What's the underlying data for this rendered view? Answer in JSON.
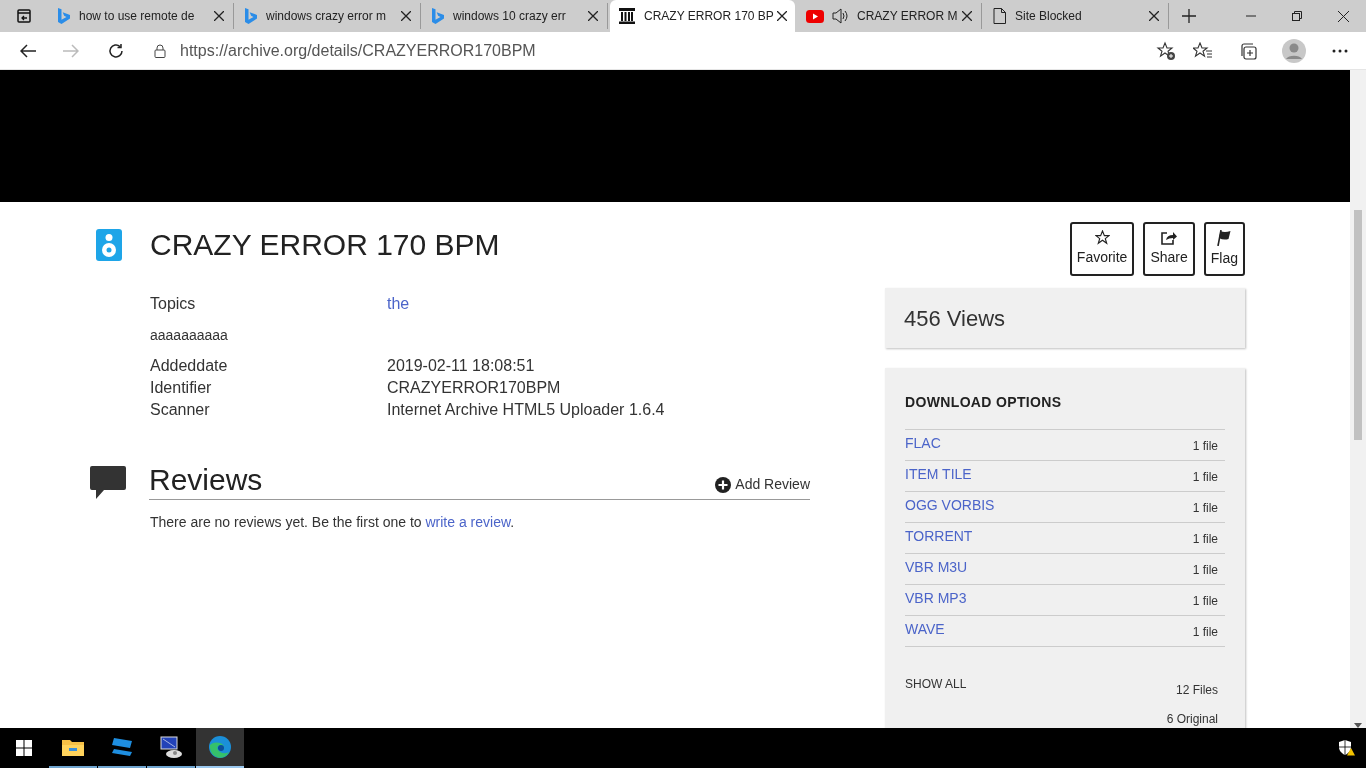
{
  "tabs": [
    {
      "title": "how to use remote de",
      "kind": "bing",
      "selected": false,
      "audio": false
    },
    {
      "title": "windows crazy error m",
      "kind": "bing",
      "selected": false,
      "audio": false
    },
    {
      "title": "windows 10 crazy err",
      "kind": "bing",
      "selected": false,
      "audio": false
    },
    {
      "title": "CRAZY ERROR 170 BP",
      "kind": "archive",
      "selected": true,
      "audio": false
    },
    {
      "title": "CRAZY ERROR M",
      "kind": "youtube",
      "selected": false,
      "audio": true
    },
    {
      "title": "Site Blocked",
      "kind": "page",
      "selected": false,
      "audio": false
    }
  ],
  "address_bar": {
    "url": "https://archive.org/details/CRAZYERROR170BPM"
  },
  "item": {
    "title": "CRAZY ERROR 170 BPM",
    "metadata": [
      {
        "label": "Topics",
        "value": "the",
        "kind": "link"
      },
      {
        "value": "aaaaaaaaaa",
        "kind": "description"
      },
      {
        "label": "Addeddate",
        "value": "2019-02-11 18:08:51",
        "kind": "text"
      },
      {
        "label": "Identifier",
        "value": "CRAZYERROR170BPM",
        "kind": "text"
      },
      {
        "label": "Scanner",
        "value": "Internet Archive HTML5 Uploader 1.6.4",
        "kind": "text"
      }
    ],
    "actions": [
      {
        "label": "Favorite",
        "kind": "star"
      },
      {
        "label": "Share",
        "kind": "share"
      },
      {
        "label": "Flag",
        "kind": "flag"
      }
    ]
  },
  "reviews": {
    "title": "Reviews",
    "add_label": "Add Review",
    "empty_text": "There are no reviews yet. Be the first one to ",
    "link": "write a review",
    "after": "."
  },
  "views": "456 Views",
  "downloads": {
    "title": "DOWNLOAD OPTIONS",
    "options": [
      {
        "format": "FLAC",
        "count": "1 file"
      },
      {
        "format": "ITEM TILE",
        "count": "1 file"
      },
      {
        "format": "OGG VORBIS",
        "count": "1 file"
      },
      {
        "format": "TORRENT",
        "count": "1 file"
      },
      {
        "format": "VBR M3U",
        "count": "1 file"
      },
      {
        "format": "VBR MP3",
        "count": "1 file"
      },
      {
        "format": "WAVE",
        "count": "1 file"
      }
    ],
    "show_all": "SHOW ALL",
    "total": "12 Files",
    "original": "6 Original"
  },
  "taskbar": [
    {
      "kind": "explorer",
      "selected": false
    },
    {
      "kind": "app",
      "selected": false
    },
    {
      "kind": "remote",
      "selected": false
    },
    {
      "kind": "edge",
      "selected": true
    }
  ]
}
